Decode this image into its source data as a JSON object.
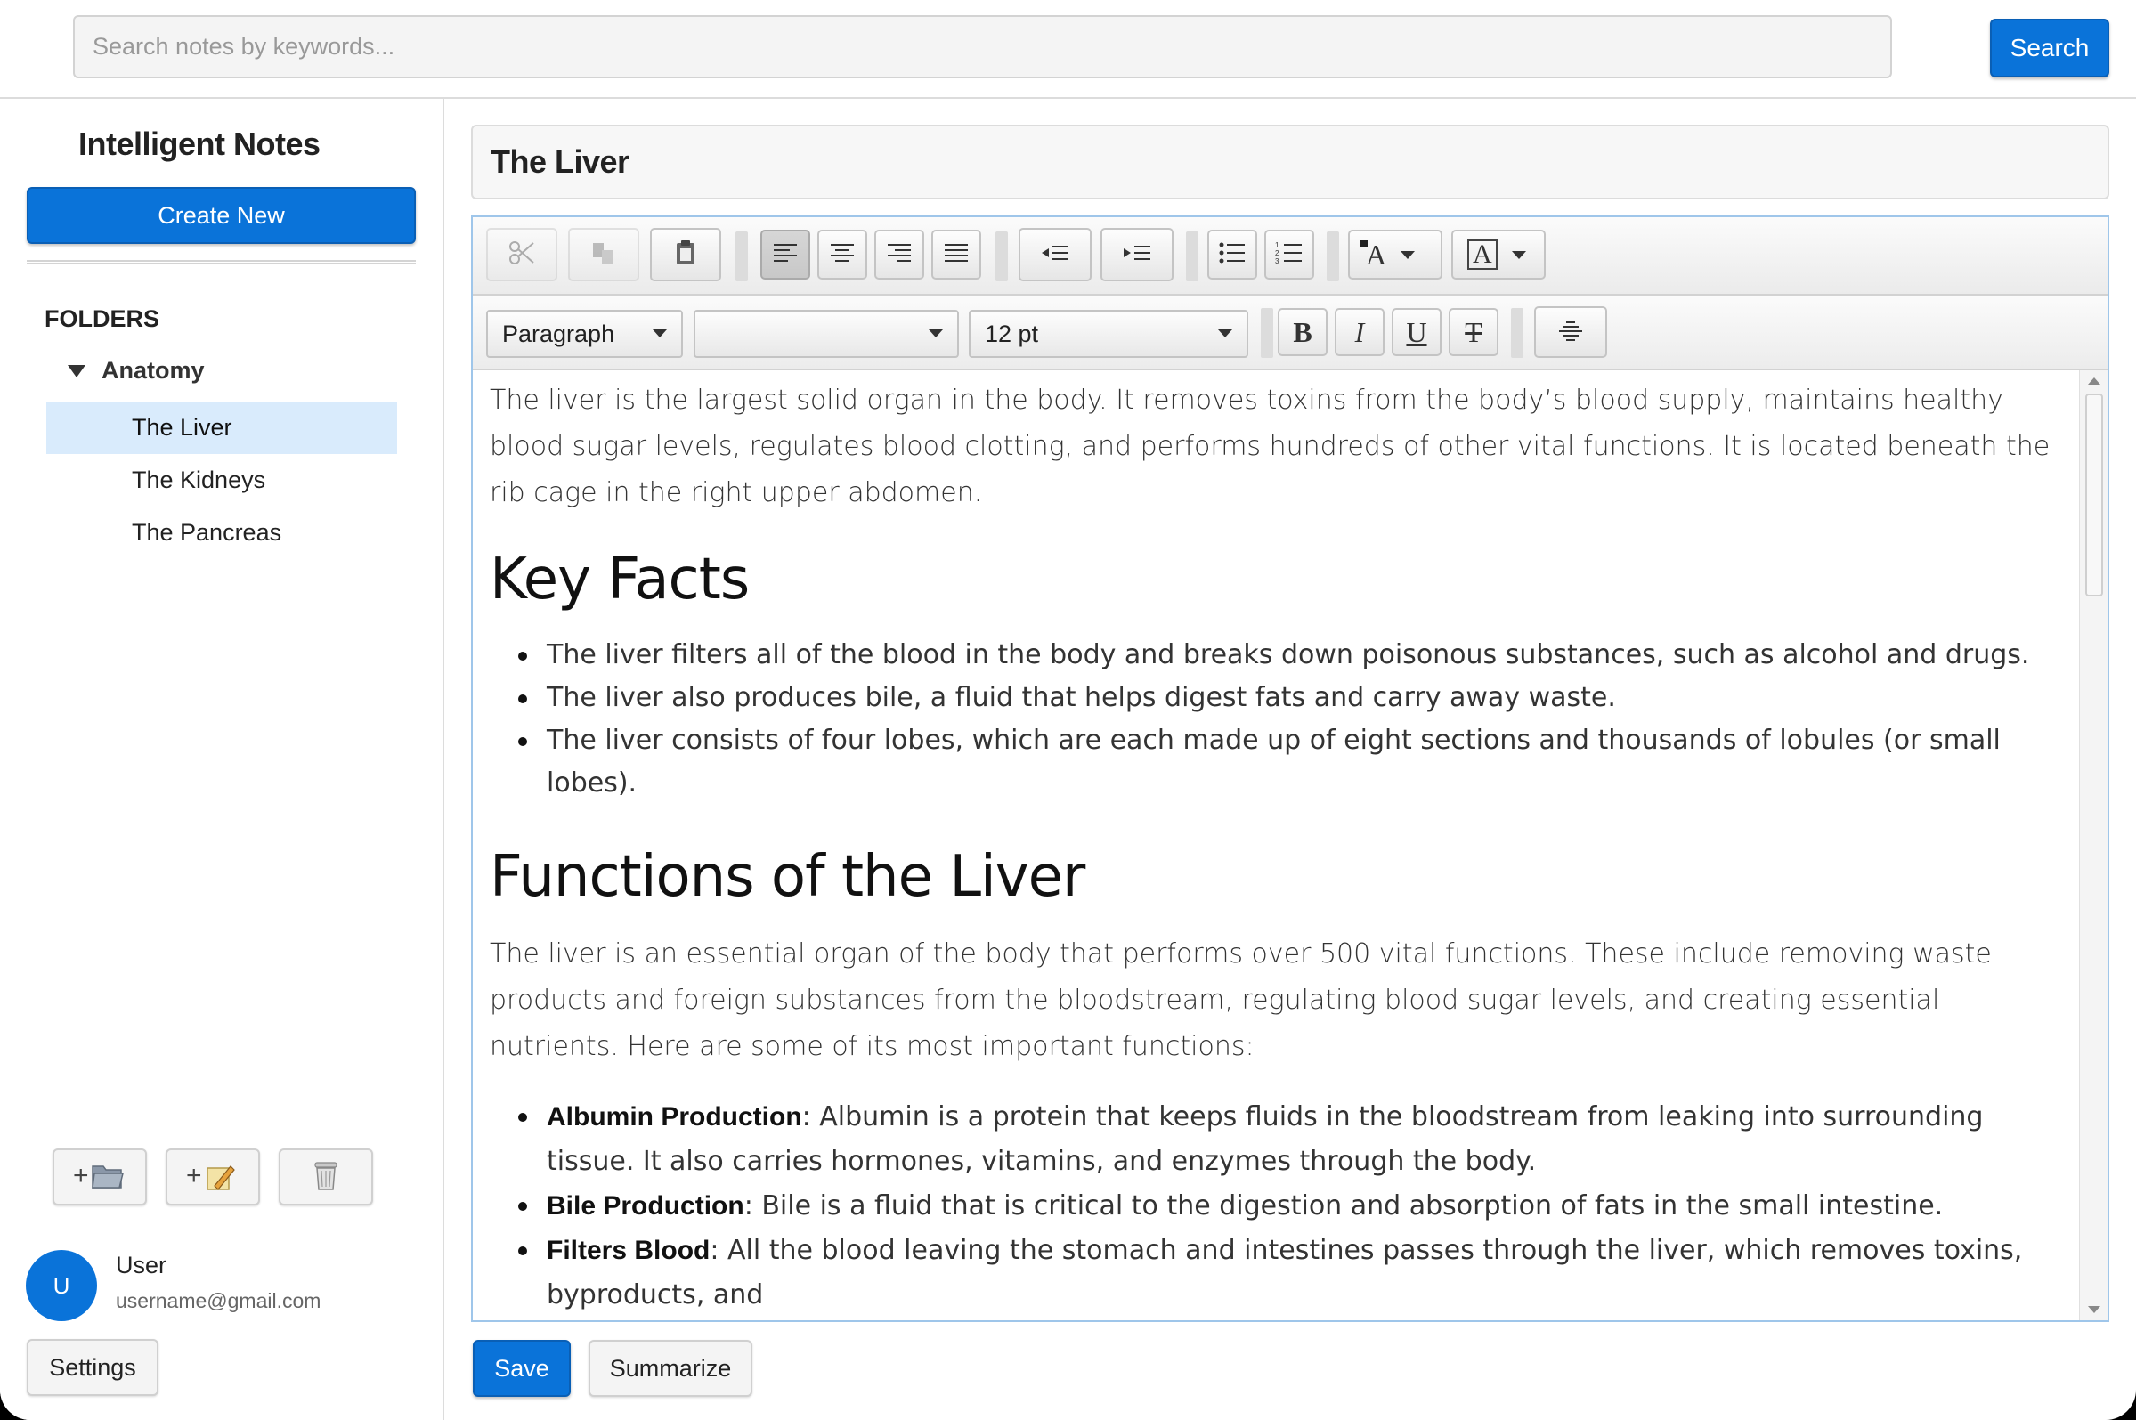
{
  "search": {
    "placeholder": "Search notes by keywords...",
    "button_label": "Search"
  },
  "sidebar": {
    "app_title": "Intelligent Notes",
    "create_label": "Create New",
    "folders_label": "FOLDERS",
    "folder": {
      "name": "Anatomy",
      "expanded": true,
      "notes": [
        {
          "title": "The Liver",
          "selected": true
        },
        {
          "title": "The Kidneys",
          "selected": false
        },
        {
          "title": "The Pancreas",
          "selected": false
        }
      ]
    },
    "actions": [
      {
        "icon": "new-folder-icon",
        "glyph": "+"
      },
      {
        "icon": "new-note-icon",
        "glyph": "+"
      },
      {
        "icon": "trash-icon"
      }
    ],
    "user": {
      "initial": "U",
      "name": "User",
      "email": "username@gmail.com"
    },
    "settings_label": "Settings"
  },
  "editor": {
    "note_title": "The Liver",
    "toolbar": {
      "block_format": "Paragraph",
      "font_family": "",
      "font_size": "12 pt",
      "bold_glyph": "B",
      "italic_glyph": "I",
      "underline_glyph": "U",
      "strike_glyph": "T",
      "text_color_glyph": "A",
      "bg_color_glyph": "A"
    },
    "content": {
      "intro": "The liver is the largest solid organ in the body. It removes toxins from the body’s blood supply, maintains healthy blood sugar levels, regulates blood clotting, and performs hundreds of other vital functions. It is located beneath the rib cage in the right upper abdomen.",
      "key_facts_heading": "Key Facts",
      "key_facts": [
        "The liver filters all of the blood in the body and breaks down poisonous substances, such as alcohol and drugs.",
        "The liver also produces bile, a fluid that helps digest fats and carry away waste.",
        "The liver consists of four lobes, which are each made up of eight sections and thousands of lobules (or small lobes)."
      ],
      "functions_heading": "Functions of the Liver",
      "functions_intro": "The liver is an essential organ of the body that performs over 500 vital functions. These include removing waste products and foreign substances from the bloodstream, regulating blood sugar levels, and creating essential nutrients. Here are some of its most important functions:",
      "functions": [
        {
          "term": "Albumin Production",
          "desc": ": Albumin is a protein that keeps fluids in the bloodstream from leaking into surrounding tissue. It also carries hormones, vitamins, and enzymes through the body."
        },
        {
          "term": "Bile Production",
          "desc": ": Bile is a fluid that is critical to the digestion and absorption of fats in the small intestine."
        },
        {
          "term": "Filters Blood",
          "desc": ": All the blood leaving the stomach and intestines passes through the liver, which removes toxins, byproducts, and"
        }
      ]
    },
    "save_label": "Save",
    "summarize_label": "Summarize"
  },
  "colors": {
    "accent": "#0a73d9",
    "selection": "#d9ebfc",
    "editor_border": "#9fc6ea"
  }
}
